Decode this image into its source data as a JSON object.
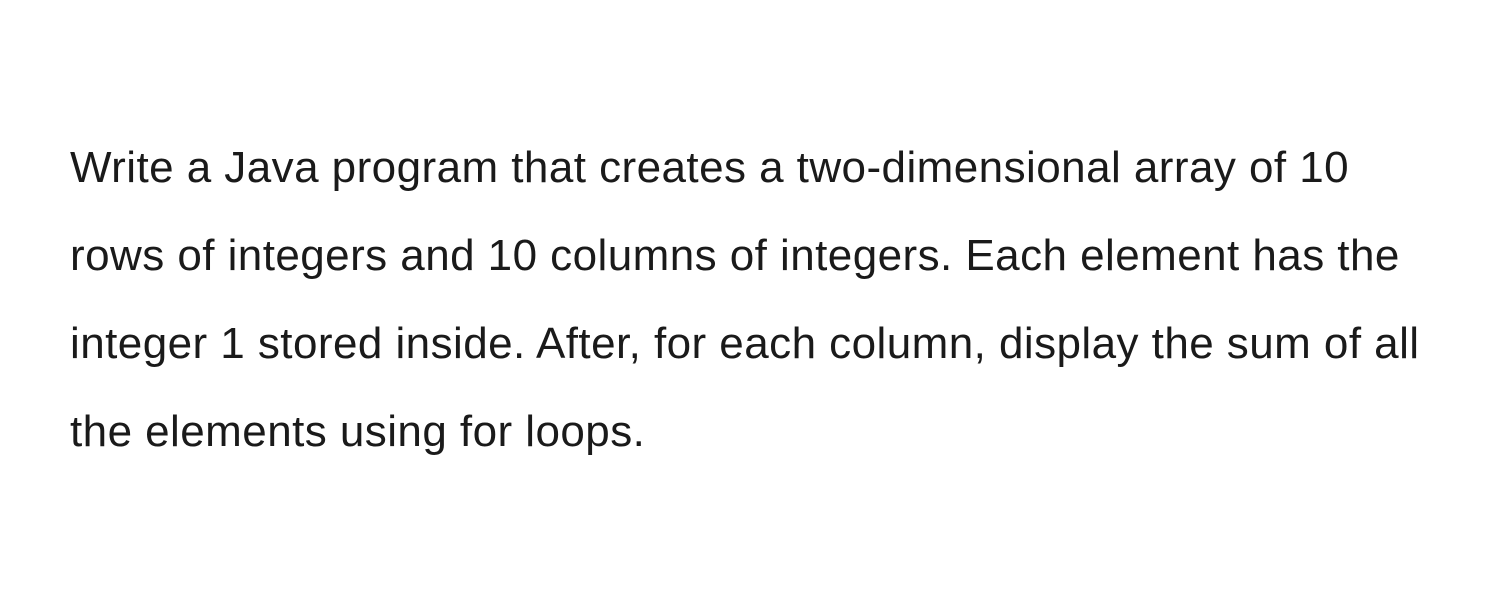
{
  "content": {
    "paragraph": "Write a Java program that creates a two-dimensional array of 10 rows of integers and 10 columns of integers. Each element has the integer 1 stored inside. After, for each column, display the sum of all the elements using for loops."
  }
}
